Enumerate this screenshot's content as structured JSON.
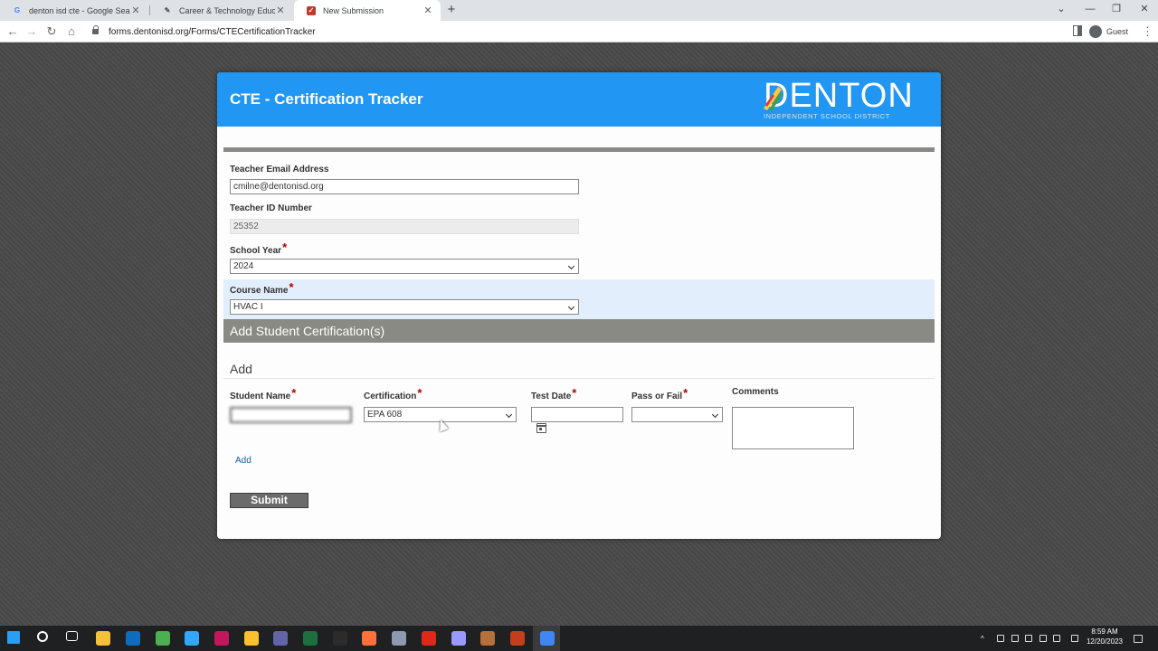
{
  "browser": {
    "tabs": [
      {
        "title": "denton isd cte - Google Search",
        "icon": "google-icon",
        "active": false
      },
      {
        "title": "Career & Technology Education /",
        "icon": "edit-icon",
        "active": false
      },
      {
        "title": "New Submission",
        "icon": "checkmark-icon",
        "active": true
      }
    ],
    "url": "forms.dentonisd.org/Forms/CTECertificationTracker",
    "profile_label": "Guest"
  },
  "form": {
    "title": "CTE - Certification Tracker",
    "logo_word": "DENTON",
    "logo_sub": "INDEPENDENT SCHOOL DISTRICT",
    "teacher_email": {
      "label": "Teacher Email Address",
      "value": "cmilne@dentonisd.org"
    },
    "teacher_id": {
      "label": "Teacher ID Number",
      "value": "25352"
    },
    "school_year": {
      "label": "School Year",
      "value": "2024"
    },
    "course_name": {
      "label": "Course Name",
      "value": "HVAC I"
    },
    "section_title": "Add Student Certification(s)",
    "add_heading": "Add",
    "columns": {
      "student_name": "Student Name",
      "certification": "Certification",
      "test_date": "Test Date",
      "pass_fail": "Pass or Fail",
      "comments": "Comments"
    },
    "row": {
      "student_name": "",
      "certification": "EPA 608",
      "test_date": "",
      "pass_fail": "",
      "comments": ""
    },
    "add_link": "Add",
    "submit_label": "Submit",
    "required_marker": "*"
  },
  "taskbar": {
    "time": "8:59 AM",
    "date": "12/20/2023",
    "apps": [
      {
        "name": "start-icon",
        "color": "#2a9df4"
      },
      {
        "name": "search-icon",
        "color": "#ffffff"
      },
      {
        "name": "task-view-icon",
        "color": "#ffffff"
      },
      {
        "name": "file-explorer-icon",
        "color": "#f3c13a"
      },
      {
        "name": "outlook-icon",
        "color": "#0f6cbd"
      },
      {
        "name": "chrome-icon",
        "color": "#4caf50"
      },
      {
        "name": "photoshop-icon",
        "color": "#31a8ff"
      },
      {
        "name": "app-icon",
        "color": "#c2185b"
      },
      {
        "name": "chrome-icon",
        "color": "#fbc02d"
      },
      {
        "name": "teams-icon",
        "color": "#6264a7"
      },
      {
        "name": "excel-icon",
        "color": "#1d6f42"
      },
      {
        "name": "bridge-icon",
        "color": "#2b2b2b"
      },
      {
        "name": "firefox-icon",
        "color": "#ff7139"
      },
      {
        "name": "app-icon",
        "color": "#8e9aaf"
      },
      {
        "name": "acrobat-icon",
        "color": "#e0281a"
      },
      {
        "name": "premiere-icon",
        "color": "#9999ff"
      },
      {
        "name": "app-icon",
        "color": "#b5713a"
      },
      {
        "name": "powerpoint-icon",
        "color": "#c43e1c"
      },
      {
        "name": "chrome-icon",
        "color": "#4285f4"
      }
    ]
  }
}
